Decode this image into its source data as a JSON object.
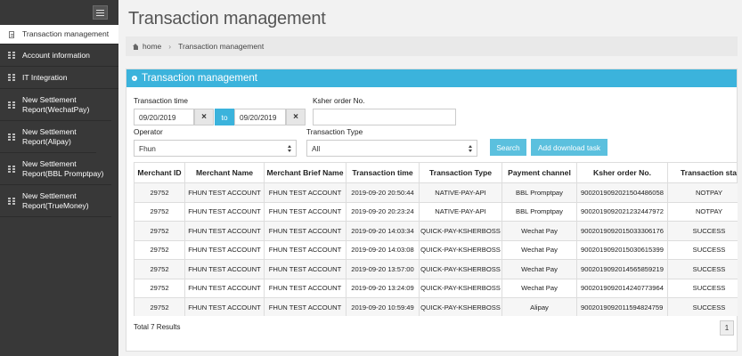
{
  "sidebar": {
    "items": [
      {
        "label": "Transaction management",
        "icon": "document-icon",
        "active": true
      },
      {
        "label": "Account information",
        "icon": "grid-icon"
      },
      {
        "label": "IT Integration",
        "icon": "grid-icon"
      },
      {
        "label": "New Settlement Report(WechatPay)",
        "icon": "grid-icon"
      },
      {
        "label": "New Settlement Report(Alipay)",
        "icon": "grid-icon"
      },
      {
        "label": "New Settlement Report(BBL Promptpay)",
        "icon": "grid-icon"
      },
      {
        "label": "New Settlement Report(TrueMoney)",
        "icon": "grid-icon"
      }
    ]
  },
  "page": {
    "title": "Transaction management",
    "breadcrumb": {
      "home": "home",
      "current": "Transaction management"
    }
  },
  "panel": {
    "title": "Transaction management"
  },
  "form": {
    "transaction_time_label": "Transaction time",
    "start_date": "09/20/2019",
    "to_label": "to",
    "end_date": "09/20/2019",
    "clear_symbol": "×",
    "ksher_order_label": "Ksher order No.",
    "ksher_order_value": "",
    "operator_label": "Operator",
    "operator_value": "Fhun",
    "transaction_type_label": "Transaction Type",
    "transaction_type_value": "All",
    "search_label": "Search",
    "download_label": "Add download task"
  },
  "table": {
    "columns": [
      "Merchant ID",
      "Merchant Name",
      "Merchant Brief Name",
      "Transaction time",
      "Transaction Type",
      "Payment channel",
      "Ksher order No.",
      "Transaction sta"
    ],
    "rows": [
      [
        "29752",
        "FHUN TEST ACCOUNT",
        "FHUN TEST ACCOUNT",
        "2019-09-20 20:50:44",
        "NATIVE-PAY-API",
        "BBL Promptpay",
        "9002019092021504486058",
        "NOTPAY"
      ],
      [
        "29752",
        "FHUN TEST ACCOUNT",
        "FHUN TEST ACCOUNT",
        "2019-09-20 20:23:24",
        "NATIVE-PAY-API",
        "BBL Promptpay",
        "9002019092021232447972",
        "NOTPAY"
      ],
      [
        "29752",
        "FHUN TEST ACCOUNT",
        "FHUN TEST ACCOUNT",
        "2019-09-20 14:03:34",
        "QUICK-PAY-KSHERBOSS",
        "Wechat Pay",
        "9002019092015033306176",
        "SUCCESS"
      ],
      [
        "29752",
        "FHUN TEST ACCOUNT",
        "FHUN TEST ACCOUNT",
        "2019-09-20 14:03:08",
        "QUICK-PAY-KSHERBOSS",
        "Wechat Pay",
        "9002019092015030615399",
        "SUCCESS"
      ],
      [
        "29752",
        "FHUN TEST ACCOUNT",
        "FHUN TEST ACCOUNT",
        "2019-09-20 13:57:00",
        "QUICK-PAY-KSHERBOSS",
        "Wechat Pay",
        "9002019092014565859219",
        "SUCCESS"
      ],
      [
        "29752",
        "FHUN TEST ACCOUNT",
        "FHUN TEST ACCOUNT",
        "2019-09-20 13:24:09",
        "QUICK-PAY-KSHERBOSS",
        "Wechat Pay",
        "9002019092014240773964",
        "SUCCESS"
      ],
      [
        "29752",
        "FHUN TEST ACCOUNT",
        "FHUN TEST ACCOUNT",
        "2019-09-20 10:59:49",
        "QUICK-PAY-KSHERBOSS",
        "Alipay",
        "9002019092011594824759",
        "SUCCESS"
      ]
    ]
  },
  "footer": {
    "total": "Total 7 Results",
    "page": "1"
  },
  "colors": {
    "sidebar_bg": "#383838",
    "accent": "#3bb3dc",
    "button": "#5bc0de"
  }
}
